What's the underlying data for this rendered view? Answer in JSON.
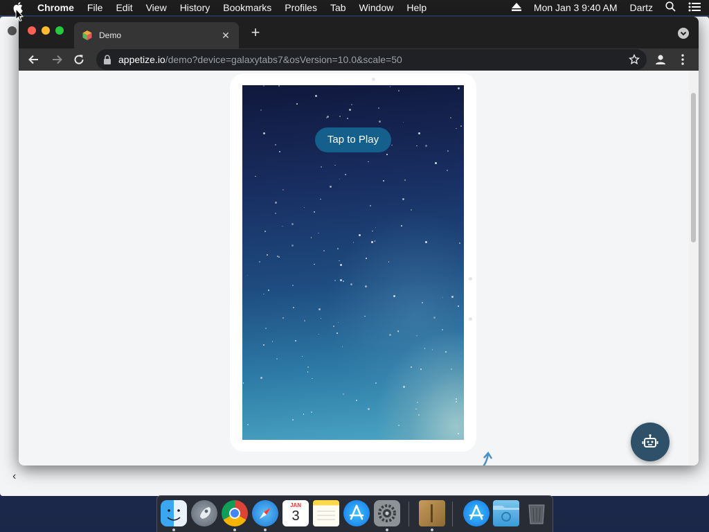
{
  "menubar": {
    "app_name": "Chrome",
    "items": [
      "File",
      "Edit",
      "View",
      "History",
      "Bookmarks",
      "Profiles",
      "Tab",
      "Window",
      "Help"
    ],
    "datetime": "Mon Jan 3  9:40 AM",
    "user": "Dartz"
  },
  "browser": {
    "tab_title": "Demo",
    "url_host": "appetize.io",
    "url_path": "/demo?device=galaxytabs7&osVersion=10.0&scale=50"
  },
  "device": {
    "play_button_label": "Tap to Play"
  },
  "dock": {
    "calendar_month": "JAN",
    "calendar_day": "3"
  }
}
